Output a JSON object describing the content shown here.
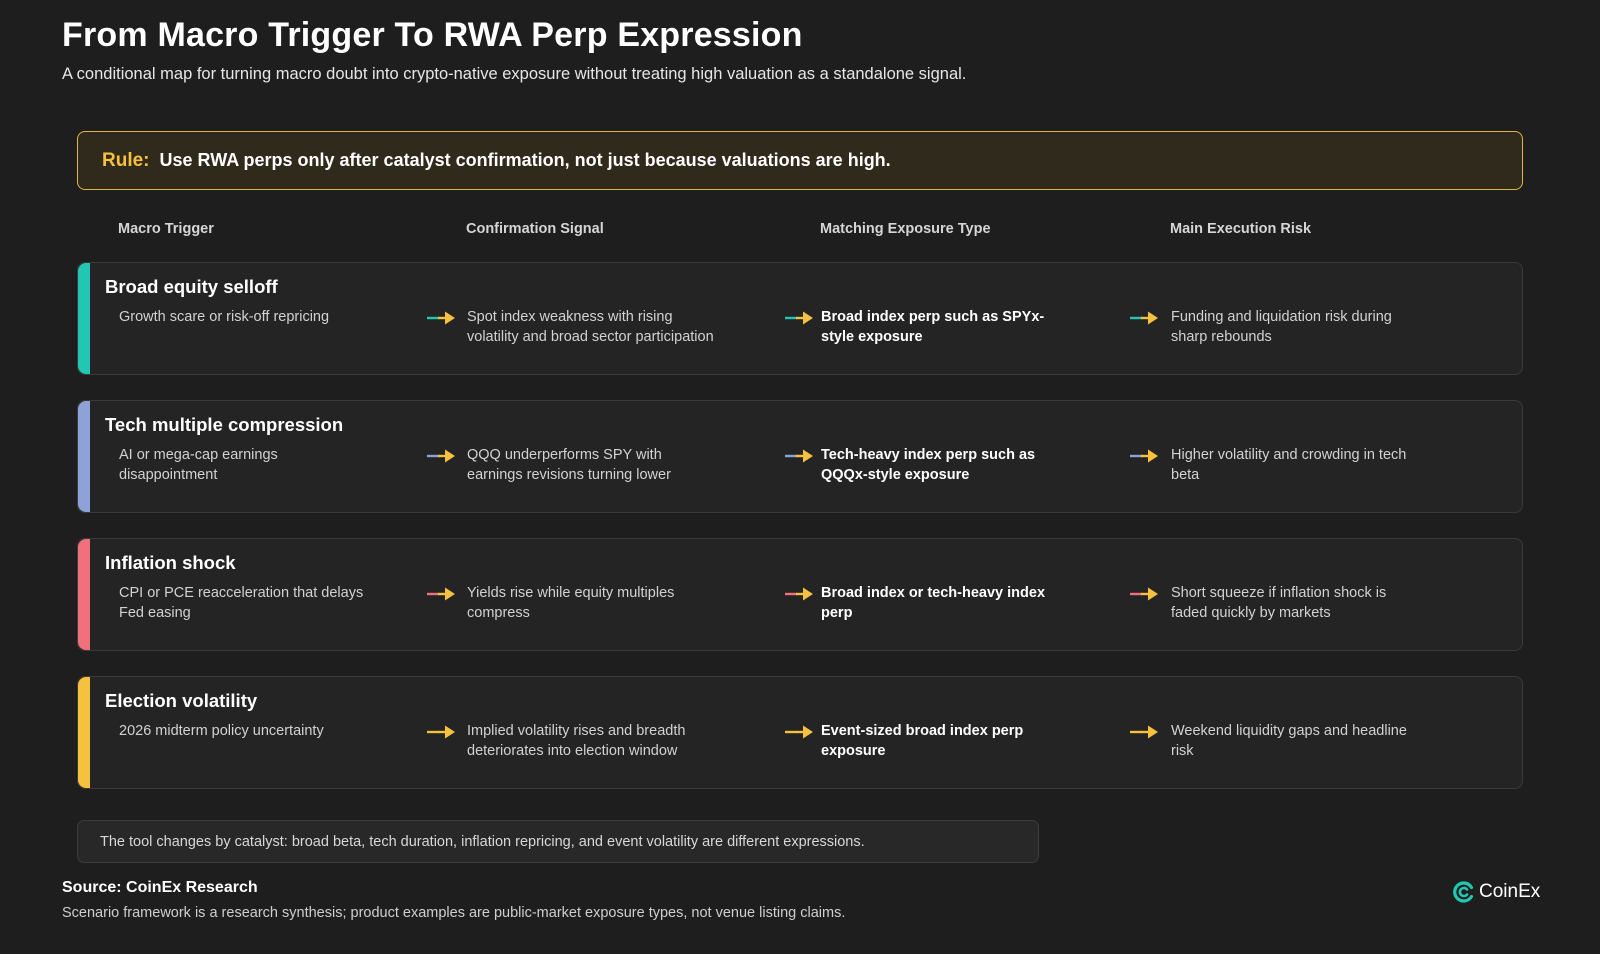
{
  "title": "From Macro Trigger To RWA Perp Expression",
  "subtitle": "A conditional map for turning macro doubt into crypto-native exposure without treating high valuation as a standalone signal.",
  "rule": {
    "label": "Rule:",
    "text": "Use RWA perps only after catalyst confirmation, not just because valuations are high."
  },
  "columns": [
    "Macro Trigger",
    "Confirmation Signal",
    "Matching Exposure Type",
    "Main Execution Risk"
  ],
  "rows": [
    {
      "title": "Broad equity selloff",
      "color": "#22c7b4",
      "trigger": "Growth scare or risk-off repricing",
      "signal": "Spot index weakness with rising volatility and broad sector participation",
      "exposure": "Broad index perp such as SPYx-style exposure",
      "risk": "Funding and liquidation risk during sharp rebounds"
    },
    {
      "title": "Tech multiple compression",
      "color": "#8ea2d8",
      "trigger": "AI or mega-cap earnings disappointment",
      "signal": "QQQ underperforms SPY with earnings revisions turning lower",
      "exposure": "Tech-heavy index perp such as QQQx-style exposure",
      "risk": "Higher volatility and crowding in tech beta"
    },
    {
      "title": "Inflation shock",
      "color": "#f0707e",
      "trigger": "CPI or PCE reacceleration that delays Fed easing",
      "signal": "Yields rise while equity multiples compress",
      "exposure": "Broad index or tech-heavy index perp",
      "risk": "Short squeeze if inflation shock is faded quickly by markets"
    },
    {
      "title": "Election volatility",
      "color": "#f5c13e",
      "trigger": "2026 midterm policy uncertainty",
      "signal": "Implied volatility rises and breadth deteriorates into election window",
      "exposure": "Event-sized broad index perp exposure",
      "risk": "Weekend liquidity gaps and headline risk"
    }
  ],
  "arrow_head_color": "#f5c13e",
  "note": "The tool changes by catalyst: broad beta, tech duration, inflation repricing, and event volatility are different expressions.",
  "source": "Source: CoinEx Research",
  "footnote": "Scenario framework is a research synthesis; product examples are public-market exposure types, not venue listing claims.",
  "logo_text": "CoinEx"
}
